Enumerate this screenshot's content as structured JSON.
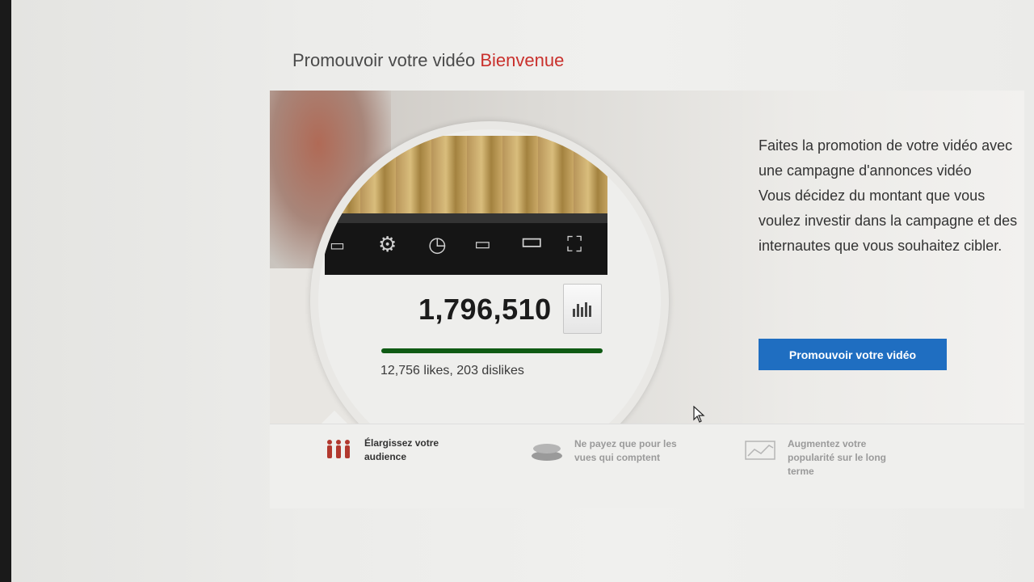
{
  "header": {
    "title": "Promouvoir votre vidéo",
    "title_accent": "Bienvenue"
  },
  "preview": {
    "view_count": "1,796,510",
    "likes_text": "12,756 likes, 203 dislikes",
    "like_ratio": 0.98,
    "controls": [
      "captions-icon",
      "settings-gear-icon",
      "watch-later-clock-icon",
      "small-player-icon",
      "large-player-icon",
      "fullscreen-icon"
    ],
    "stats_icon": "bar-chart-icon"
  },
  "promo": {
    "line1": "Faites la promotion de votre vidéo avec une campagne d'annonces vidéo",
    "line2": "Vous décidez du montant que vous voulez investir dans la campagne et des internautes que vous souhaitez cibler.",
    "button": "Promouvoir votre vidéo",
    "button_color": "#1f6ec1"
  },
  "features": [
    {
      "icon": "people-icon",
      "text": "Élargissez votre audience"
    },
    {
      "icon": "coins-icon",
      "text": "Ne payez que pour les vues qui comptent"
    },
    {
      "icon": "growth-chart-icon",
      "text": "Augmentez votre popularité sur le long terme"
    }
  ],
  "colors": {
    "accent": "#c9302c",
    "like_bar": "#0f5a14"
  }
}
